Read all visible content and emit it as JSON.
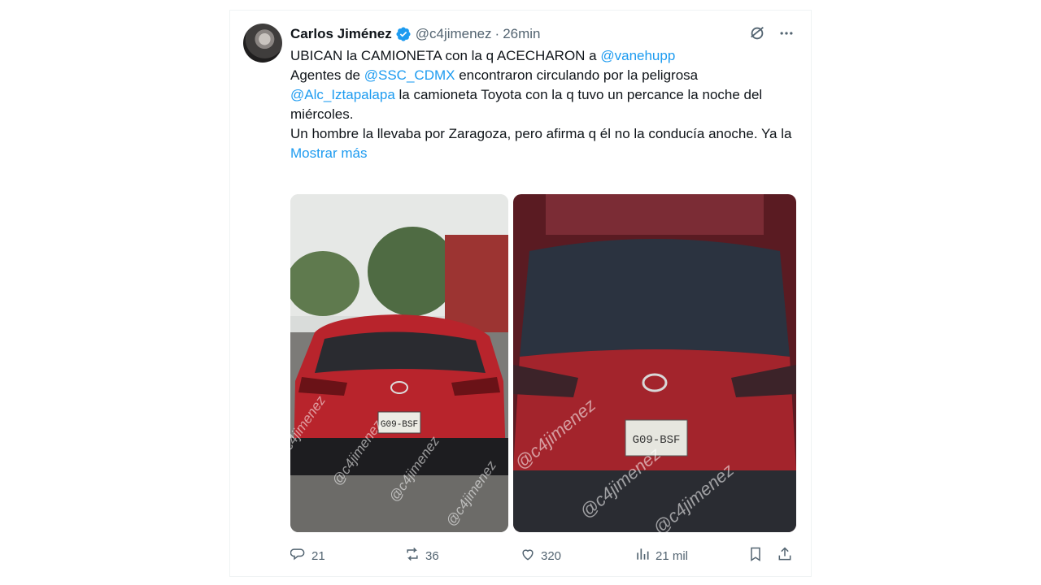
{
  "author": {
    "name": "Carlos Jiménez",
    "handle": "@c4jimenez",
    "separator": "·",
    "time": "26min",
    "verified": true
  },
  "tweet": {
    "line1_prefix": "UBICAN la CAMIONETA con la q ACECHARON a ",
    "line1_mention": "@vanehupp",
    "line2_prefix": "Agentes de ",
    "line2_mention": "@SSC_CDMX",
    "line2_suffix": " encontraron circulando por la peligrosa",
    "line3_mention": "@Alc_Iztapalapa",
    "line3_suffix": " la camioneta Toyota con la q tuvo un percance la noche del miércoles.",
    "line4": "Un hombre la llevaba por Zaragoza, pero afirma q él no la conducía anoche. Ya la",
    "show_more": "Mostrar más"
  },
  "media": {
    "image1_plate": "G09-BSF",
    "image2_plate": "G09-BSF",
    "watermark": "@c4jimenez"
  },
  "actions": {
    "replies": "21",
    "reposts": "36",
    "likes": "320",
    "views": "21 mil"
  },
  "colors": {
    "accent": "#1d9bf0",
    "muted": "#536471",
    "car_red": "#b8242c"
  },
  "icons": [
    "verified-badge-icon",
    "grok-icon",
    "more-icon",
    "reply-icon",
    "repost-icon",
    "like-icon",
    "views-icon",
    "bookmark-icon",
    "share-icon"
  ]
}
